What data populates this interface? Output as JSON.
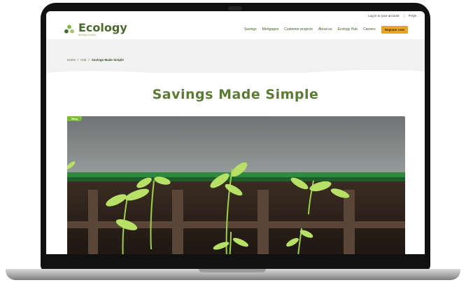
{
  "topbar": {
    "login_label": "Log in to your account",
    "faqs_label": "FAQs",
    "separator": "|"
  },
  "brand": {
    "name": "Ecology",
    "tagline": "Building Society",
    "primary_color": "#4b6a2e",
    "accent_color": "#e8a623"
  },
  "nav": {
    "items": [
      "Savings",
      "Mortgages",
      "Customer projects",
      "About us",
      "Ecology Hub",
      "Careers"
    ],
    "cta_label": "Register now"
  },
  "breadcrumb": {
    "items": [
      "Home",
      "Hub"
    ],
    "separator": "/",
    "current": "Savings Made Simple"
  },
  "page": {
    "title": "Savings Made Simple"
  },
  "hero": {
    "badge_label": "Blog",
    "image_icon": "seedlings-in-soil-trays"
  }
}
